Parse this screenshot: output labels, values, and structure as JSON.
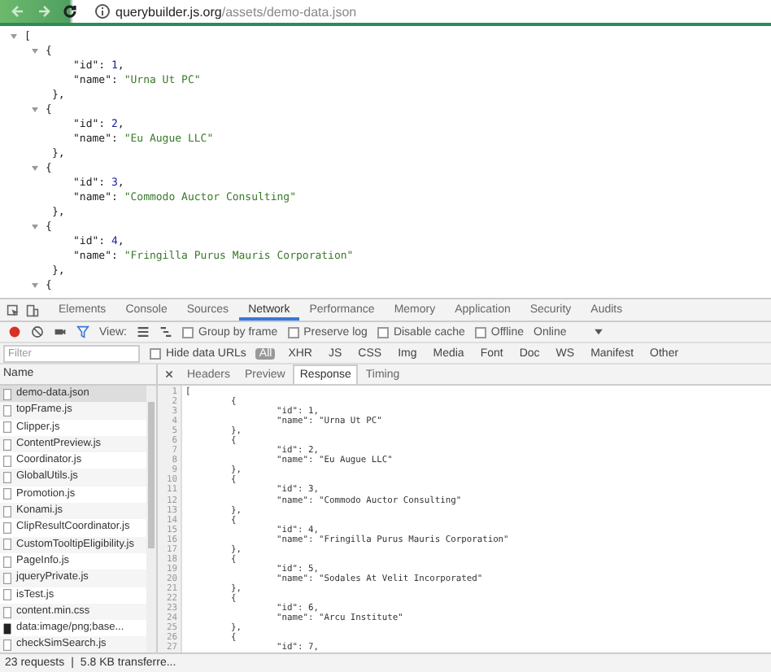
{
  "address_bar": {
    "host": "querybuilder.js.org",
    "path": "/assets/demo-data.json"
  },
  "json_viewer": {
    "open": "[",
    "records": [
      {
        "open": "{",
        "fields": [
          {
            "key": "\"id\"",
            "sep": ":",
            "value": "1",
            "kind": "number",
            "tail": ","
          },
          {
            "key": "\"name\"",
            "sep": ":",
            "value": "\"Urna Ut PC\"",
            "kind": "string"
          }
        ],
        "close": "},"
      },
      {
        "open": "{",
        "fields": [
          {
            "key": "\"id\"",
            "sep": ":",
            "value": "2",
            "kind": "number",
            "tail": ","
          },
          {
            "key": "\"name\"",
            "sep": ":",
            "value": "\"Eu Augue LLC\"",
            "kind": "string"
          }
        ],
        "close": "},"
      },
      {
        "open": "{",
        "fields": [
          {
            "key": "\"id\"",
            "sep": ":",
            "value": "3",
            "kind": "number",
            "tail": ","
          },
          {
            "key": "\"name\"",
            "sep": ":",
            "value": "\"Commodo Auctor Consulting\"",
            "kind": "string"
          }
        ],
        "close": "},"
      },
      {
        "open": "{",
        "fields": [
          {
            "key": "\"id\"",
            "sep": ":",
            "value": "4",
            "kind": "number",
            "tail": ","
          },
          {
            "key": "\"name\"",
            "sep": ":",
            "value": "\"Fringilla Purus Mauris Corporation\"",
            "kind": "string"
          }
        ],
        "close": "},"
      },
      {
        "open": "{"
      }
    ]
  },
  "devtools": {
    "tabs": [
      {
        "label": "Elements",
        "selected": false
      },
      {
        "label": "Console",
        "selected": false
      },
      {
        "label": "Sources",
        "selected": false
      },
      {
        "label": "Network",
        "selected": true
      },
      {
        "label": "Performance",
        "selected": false
      },
      {
        "label": "Memory",
        "selected": false
      },
      {
        "label": "Application",
        "selected": false
      },
      {
        "label": "Security",
        "selected": false
      },
      {
        "label": "Audits",
        "selected": false
      }
    ],
    "toolbar": {
      "recording": true,
      "view_label": "View:",
      "options": [
        {
          "label": "Group by frame",
          "checked": false
        },
        {
          "label": "Preserve log",
          "checked": false
        },
        {
          "label": "Disable cache",
          "checked": false
        },
        {
          "label": "Offline",
          "checked": false
        }
      ],
      "throttle": "Online"
    },
    "filter": {
      "placeholder": "Filter",
      "hide_data_urls": {
        "label": "Hide data URLs",
        "checked": false
      },
      "types": [
        {
          "label": "All",
          "selected": true
        },
        {
          "label": "XHR",
          "selected": false
        },
        {
          "label": "JS",
          "selected": false
        },
        {
          "label": "CSS",
          "selected": false
        },
        {
          "label": "Img",
          "selected": false
        },
        {
          "label": "Media",
          "selected": false
        },
        {
          "label": "Font",
          "selected": false
        },
        {
          "label": "Doc",
          "selected": false
        },
        {
          "label": "WS",
          "selected": false
        },
        {
          "label": "Manifest",
          "selected": false
        },
        {
          "label": "Other",
          "selected": false
        }
      ]
    },
    "requests": {
      "header": "Name",
      "items": [
        {
          "name": "demo-data.json",
          "kind": "file",
          "selected": true
        },
        {
          "name": "topFrame.js",
          "kind": "file",
          "selected": false
        },
        {
          "name": "Clipper.js",
          "kind": "file",
          "selected": false
        },
        {
          "name": "ContentPreview.js",
          "kind": "file",
          "selected": false
        },
        {
          "name": "Coordinator.js",
          "kind": "file",
          "selected": false
        },
        {
          "name": "GlobalUtils.js",
          "kind": "file",
          "selected": false
        },
        {
          "name": "Promotion.js",
          "kind": "file",
          "selected": false
        },
        {
          "name": "Konami.js",
          "kind": "file",
          "selected": false
        },
        {
          "name": "ClipResultCoordinator.js",
          "kind": "file",
          "selected": false
        },
        {
          "name": "CustomTooltipEligibility.js",
          "kind": "file",
          "selected": false
        },
        {
          "name": "PageInfo.js",
          "kind": "file",
          "selected": false
        },
        {
          "name": "jqueryPrivate.js",
          "kind": "file",
          "selected": false
        },
        {
          "name": "isTest.js",
          "kind": "file",
          "selected": false
        },
        {
          "name": "content.min.css",
          "kind": "file",
          "selected": false
        },
        {
          "name": "data:image/png;base...",
          "kind": "image",
          "selected": false
        },
        {
          "name": "checkSimSearch.js",
          "kind": "file",
          "selected": false
        }
      ]
    },
    "detail_tabs": [
      {
        "label": "Headers",
        "selected": false
      },
      {
        "label": "Preview",
        "selected": false
      },
      {
        "label": "Response",
        "selected": true
      },
      {
        "label": "Timing",
        "selected": false
      }
    ],
    "response": {
      "line_numbers": [
        "1",
        "2",
        "3",
        "4",
        "5",
        "6",
        "7",
        "8",
        "9",
        "10",
        "11",
        "12",
        "13",
        "14",
        "15",
        "16",
        "17",
        "18",
        "19",
        "20",
        "21",
        "22",
        "23",
        "24",
        "25",
        "26",
        "27"
      ],
      "open": "[",
      "records": [
        {
          "open": "{",
          "fields": [
            "\"id\": 1,",
            "\"name\": \"Urna Ut PC\""
          ],
          "close": "},"
        },
        {
          "open": "{",
          "fields": [
            "\"id\": 2,",
            "\"name\": \"Eu Augue LLC\""
          ],
          "close": "},"
        },
        {
          "open": "{",
          "fields": [
            "\"id\": 3,",
            "\"name\": \"Commodo Auctor Consulting\""
          ],
          "close": "},"
        },
        {
          "open": "{",
          "fields": [
            "\"id\": 4,",
            "\"name\": \"Fringilla Purus Mauris Corporation\""
          ],
          "close": "},"
        },
        {
          "open": "{",
          "fields": [
            "\"id\": 5,",
            "\"name\": \"Sodales At Velit Incorporated\""
          ],
          "close": "},"
        },
        {
          "open": "{",
          "fields": [
            "\"id\": 6,",
            "\"name\": \"Arcu Institute\""
          ],
          "close": "},"
        },
        {
          "open": "{",
          "fields": [
            "\"id\": 7,"
          ]
        }
      ]
    },
    "status": {
      "requests": "23 requests",
      "separator": "|",
      "transferred": "5.8 KB transferre..."
    }
  }
}
